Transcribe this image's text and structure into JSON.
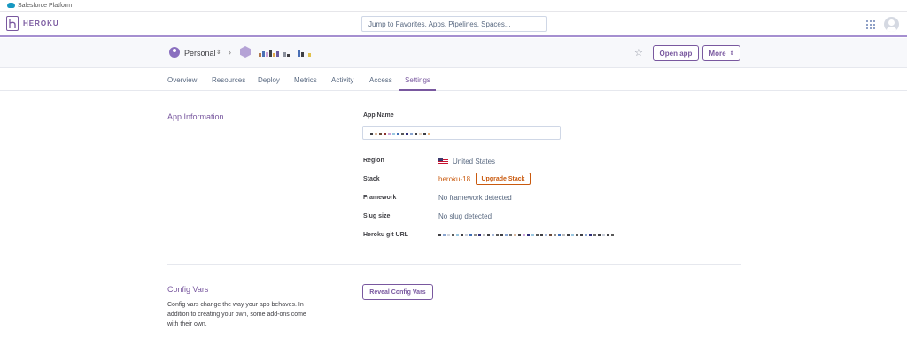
{
  "platform": {
    "label": "Salesforce Platform"
  },
  "header": {
    "wordmark": "HEROKU",
    "search_placeholder": "Jump to Favorites, Apps, Pipelines, Spaces..."
  },
  "app_bar": {
    "account_label": "Personal",
    "open_app_label": "Open app",
    "more_label": "More"
  },
  "tabs": [
    {
      "label": "Overview"
    },
    {
      "label": "Resources"
    },
    {
      "label": "Deploy"
    },
    {
      "label": "Metrics"
    },
    {
      "label": "Activity"
    },
    {
      "label": "Access"
    },
    {
      "label": "Settings",
      "active": true
    }
  ],
  "app_info": {
    "section_title": "App Information",
    "app_name_label": "App Name",
    "region_label": "Region",
    "region_value": "United States",
    "stack_label": "Stack",
    "stack_value": "heroku-18",
    "upgrade_stack_label": "Upgrade Stack",
    "framework_label": "Framework",
    "framework_value": "No framework detected",
    "slug_label": "Slug size",
    "slug_value": "No slug detected",
    "git_url_label": "Heroku git URL"
  },
  "config_vars": {
    "section_title": "Config Vars",
    "description": "Config vars change the way your app behaves. In addition to creating your own, some add-ons come with their own.",
    "reveal_label": "Reveal Config Vars"
  },
  "colors": {
    "accent": "#79589f",
    "stack_orange": "#c9590d",
    "band_bg": "#f7f8fb"
  }
}
